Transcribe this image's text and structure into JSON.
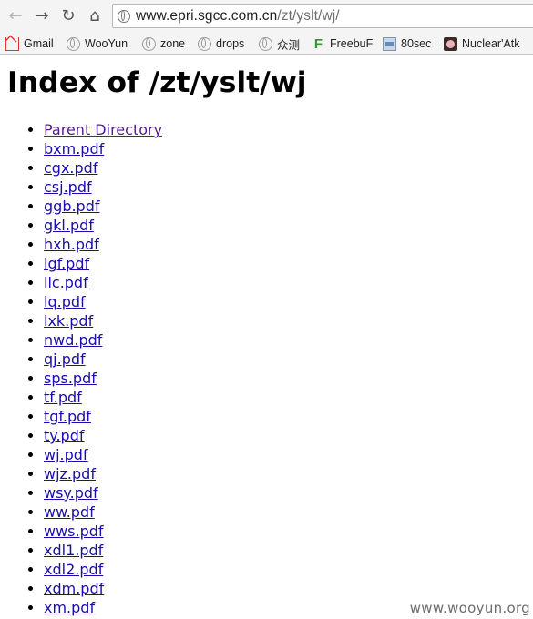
{
  "toolbar": {
    "url_host": "www.epri.sgcc.com.cn",
    "url_path": "/zt/yslt/wj/"
  },
  "bookmarks": [
    {
      "label": "Gmail",
      "icon": "gmail-icon"
    },
    {
      "label": "WooYun",
      "icon": "globe-icon"
    },
    {
      "label": "zone",
      "icon": "globe-icon"
    },
    {
      "label": "drops",
      "icon": "globe-icon"
    },
    {
      "label": "众测",
      "icon": "globe-icon"
    },
    {
      "label": "FreebuF",
      "icon": "freebuf-icon"
    },
    {
      "label": "80sec",
      "icon": "80sec-icon"
    },
    {
      "label": "Nuclear'Atk",
      "icon": "nuclear-icon"
    }
  ],
  "page": {
    "title": "Index of /zt/yslt/wj",
    "parent_link": "Parent Directory",
    "files": [
      "bxm.pdf",
      "cgx.pdf",
      "csj.pdf",
      "ggb.pdf",
      "gkl.pdf",
      "hxh.pdf",
      "lgf.pdf",
      "llc.pdf",
      "lq.pdf",
      "lxk.pdf",
      "nwd.pdf",
      "qj.pdf",
      "sps.pdf",
      "tf.pdf",
      "tgf.pdf",
      "ty.pdf",
      "wj.pdf",
      "wjz.pdf",
      "wsy.pdf",
      "ww.pdf",
      "wws.pdf",
      "xdl1.pdf",
      "xdl2.pdf",
      "xdm.pdf",
      "xm.pdf"
    ]
  },
  "watermark": "www.wooyun.org",
  "colors": {
    "link": "#1a0dab",
    "visited_link": "#551a8b"
  }
}
